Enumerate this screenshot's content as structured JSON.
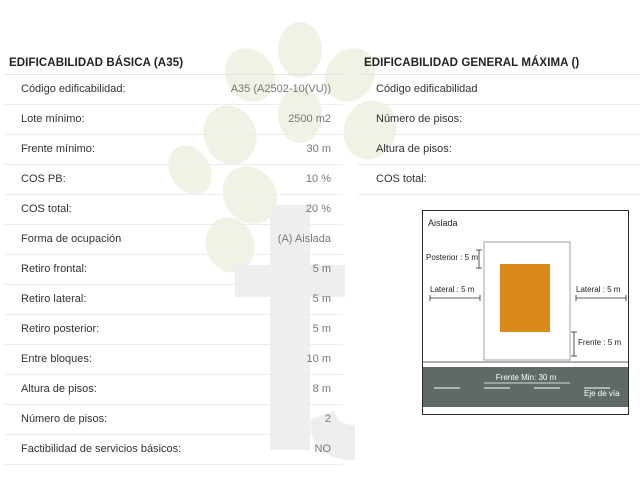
{
  "basic": {
    "title": "EDIFICABILIDAD BÁSICA (A35)",
    "rows": [
      {
        "label": "Código edificabilidad:",
        "value": "A35 (A2502-10(VU))"
      },
      {
        "label": "Lote mínimo:",
        "value": "2500 m2"
      },
      {
        "label": "Frente mínimo:",
        "value": "30 m"
      },
      {
        "label": "COS PB:",
        "value": "10 %"
      },
      {
        "label": "COS total:",
        "value": "20 %"
      },
      {
        "label": "Forma de ocupación",
        "value": "(A) Aislada"
      },
      {
        "label": "Retiro frontal:",
        "value": "5 m"
      },
      {
        "label": "Retiro lateral:",
        "value": "5 m"
      },
      {
        "label": "Retiro posterior:",
        "value": "5 m"
      },
      {
        "label": "Entre bloques:",
        "value": "10 m"
      },
      {
        "label": "Altura de pisos:",
        "value": "8 m"
      },
      {
        "label": "Número de pisos:",
        "value": "2"
      },
      {
        "label": "Factibilidad de servicios básicos:",
        "value": "NO"
      }
    ]
  },
  "general": {
    "title": "EDIFICABILIDAD GENERAL MÁXIMA ()",
    "rows": [
      {
        "label": "Código edificabilidad"
      },
      {
        "label": "Número de pisos:"
      },
      {
        "label": "Altura de pisos:"
      },
      {
        "label": "COS total:"
      }
    ]
  },
  "diagram": {
    "title": "Aislada",
    "posterior": "Posterior : 5 m",
    "lateral_left": "Lateral : 5 m",
    "lateral_right": "Lateral : 5 m",
    "frente": "Frente : 5 m",
    "frente_min": "Frente Min: 30 m",
    "eje_via": "Eje de vía",
    "colors": {
      "building": "#d98a1a",
      "road": "#5f6965",
      "line": "#2b2b2b",
      "lot": "#9aa7b2"
    }
  }
}
